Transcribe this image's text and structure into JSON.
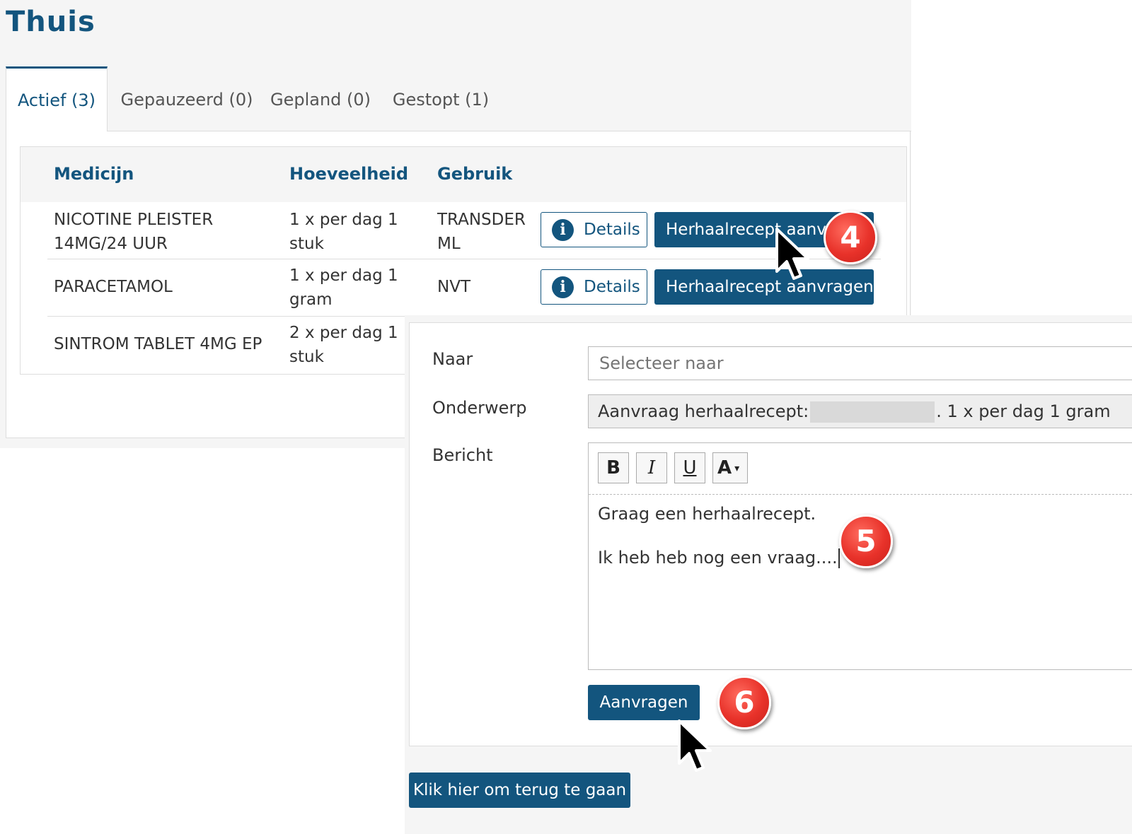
{
  "page": {
    "title": "Thuis"
  },
  "tabs": [
    {
      "label": "Actief (3)",
      "active": true
    },
    {
      "label": "Gepauzeerd (0)",
      "active": false
    },
    {
      "label": "Gepland (0)",
      "active": false
    },
    {
      "label": "Gestopt (1)",
      "active": false
    }
  ],
  "table": {
    "headers": {
      "medicijn": "Medicijn",
      "hoeveelheid": "Hoeveelheid",
      "gebruik": "Gebruik"
    },
    "rows": [
      {
        "medicijn": "NICOTINE PLEISTER\n14MG/24 UUR",
        "hoeveelheid": "1 x per dag 1\nstuk",
        "gebruik": "TRANSDER\nML",
        "details_label": "Details",
        "action_label": "Herhaalrecept aanvragen"
      },
      {
        "medicijn": "PARACETAMOL",
        "hoeveelheid": "1 x per dag 1\ngram",
        "gebruik": "NVT",
        "details_label": "Details",
        "action_label": "Herhaalrecept aanvragen"
      },
      {
        "medicijn": "SINTROM TABLET 4MG EP",
        "hoeveelheid": "2 x per dag 1\nstuk",
        "gebruik": ""
      }
    ]
  },
  "form": {
    "naar_label": "Naar",
    "naar_placeholder": "Selecteer naar",
    "onderwerp_label": "Onderwerp",
    "onderwerp_prefix": "Aanvraag herhaalrecept:",
    "onderwerp_suffix": ". 1 x per dag 1 gram",
    "bericht_label": "Bericht",
    "toolbar": {
      "bold": "B",
      "italic": "I",
      "underline": "U",
      "font_color": "A",
      "font_color_dropdown": "▾"
    },
    "message_line1": "Graag een herhaalrecept.",
    "message_line2": "Ik heb heb nog een vraag....",
    "submit_label": "Aanvragen"
  },
  "back_button_label": "Klik hier om terug te gaan",
  "badges": {
    "step4": "4",
    "step5": "5",
    "step6": "6"
  },
  "icons": {
    "info": "info-icon",
    "pointer": "mouse-pointer-icon"
  },
  "colors": {
    "brand": "#13557e",
    "badge_red": "#e8322a"
  }
}
